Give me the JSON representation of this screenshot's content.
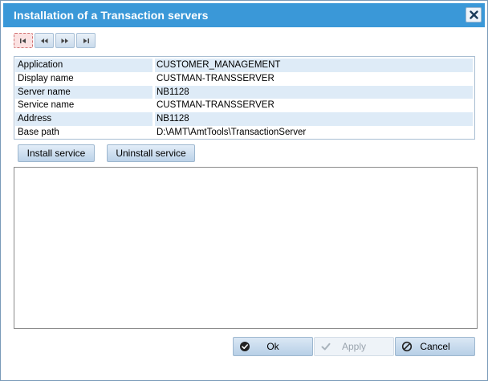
{
  "dialog": {
    "title": "Installation of a Transaction servers",
    "close_icon": "close-icon"
  },
  "nav": {
    "buttons": [
      {
        "name": "first-record-button",
        "icon": "first-icon",
        "glyph": "|◂"
      },
      {
        "name": "previous-record-button",
        "icon": "previous-icon",
        "glyph": "◂◂"
      },
      {
        "name": "next-record-button",
        "icon": "next-icon",
        "glyph": "▸▸"
      },
      {
        "name": "last-record-button",
        "icon": "last-icon",
        "glyph": "▸|"
      }
    ]
  },
  "properties": [
    {
      "key": "Application",
      "value": "CUSTOMER_MANAGEMENT"
    },
    {
      "key": "Display name",
      "value": "CUSTMAN-TRANSSERVER"
    },
    {
      "key": "Server name",
      "value": "NB1128"
    },
    {
      "key": "Service name",
      "value": "CUSTMAN-TRANSSERVER"
    },
    {
      "key": "Address",
      "value": "NB1128"
    },
    {
      "key": "Base path",
      "value": "D:\\AMT\\AmtTools\\TransactionServer"
    }
  ],
  "actions": {
    "install_label": "Install service",
    "uninstall_label": "Uninstall service"
  },
  "output": {
    "text": ""
  },
  "footer": {
    "ok_label": "Ok",
    "apply_label": "Apply",
    "cancel_label": "Cancel",
    "apply_disabled": true
  },
  "colors": {
    "titlebar": "#3a98d8",
    "row_alt": "#deebf7"
  }
}
